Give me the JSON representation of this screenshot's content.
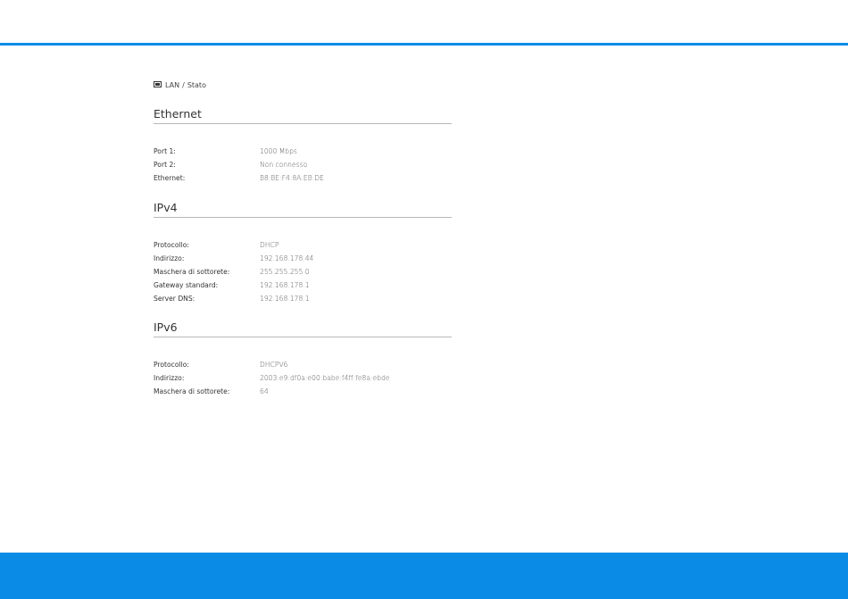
{
  "breadcrumb": {
    "icon": "lan-icon",
    "parent": "LAN",
    "separator": "/",
    "current": "Stato"
  },
  "sections": [
    {
      "title": "Ethernet",
      "rows": [
        {
          "label": "Port 1:",
          "value": "1000 Mbps"
        },
        {
          "label": "Port 2:",
          "value": "Non connesso"
        },
        {
          "label": "Ethernet:",
          "value": "B8:BE:F4:8A:EB:DE"
        }
      ]
    },
    {
      "title": "IPv4",
      "rows": [
        {
          "label": "Protocollo:",
          "value": "DHCP"
        },
        {
          "label": "Indirizzo:",
          "value": "192.168.178.44"
        },
        {
          "label": "Maschera di sottorete:",
          "value": "255.255.255.0"
        },
        {
          "label": "Gateway standard:",
          "value": "192.168.178.1"
        },
        {
          "label": "Server DNS:",
          "value": "192.168.178.1"
        }
      ]
    },
    {
      "title": "IPv6",
      "rows": [
        {
          "label": "Protocollo:",
          "value": "DHCPV6"
        },
        {
          "label": "Indirizzo:",
          "value": "2003:e9:df0a:e00:babe:f4ff:fe8a:ebde"
        },
        {
          "label": "Maschera di sottorete:",
          "value": "64"
        }
      ]
    }
  ],
  "colors": {
    "accent": "#0a8ce6"
  }
}
